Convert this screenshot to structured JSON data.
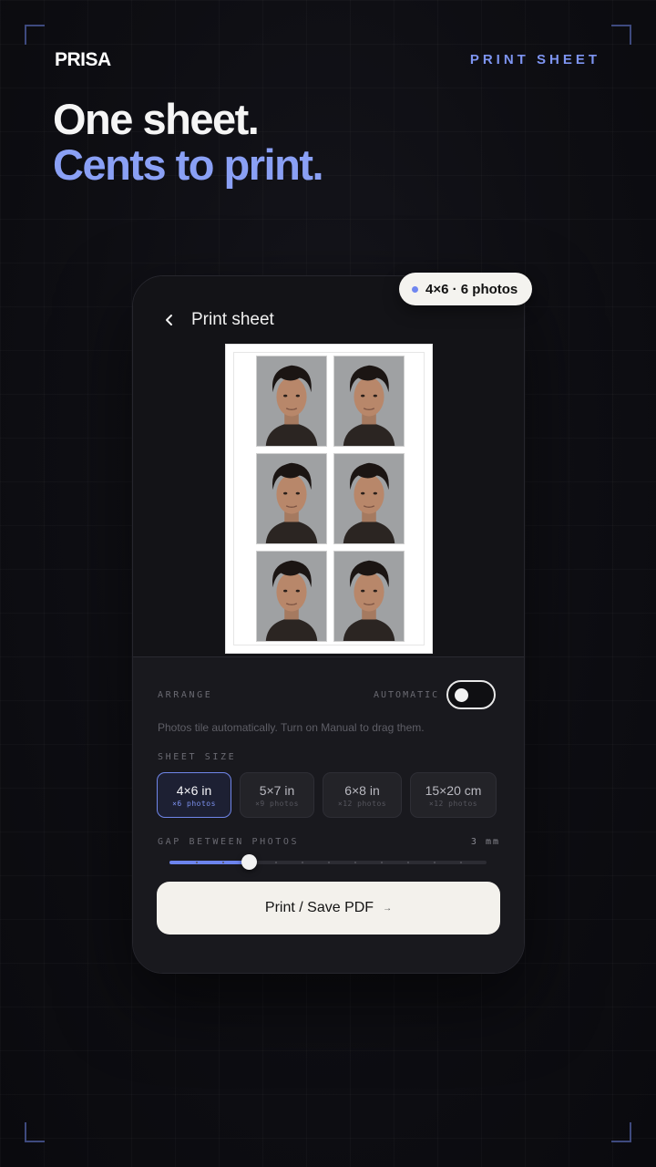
{
  "brand": "PRISA",
  "tag": "PRINT SHEET",
  "hero": {
    "line1": "One sheet.",
    "line2": "Cents to print."
  },
  "badge": {
    "label": "4×6 · 6 photos"
  },
  "screen": {
    "title": "Print sheet",
    "back_icon": "chevron-left-icon"
  },
  "sheet": {
    "photo_count": 6,
    "columns": 2,
    "rows": 3
  },
  "arrange": {
    "label": "ARRANGE",
    "mode_label": "AUTOMATIC",
    "toggle_on": false,
    "help": "Photos tile automatically. Turn on Manual to drag them."
  },
  "sheet_size": {
    "label": "SHEET SIZE",
    "options": [
      {
        "title": "4×6 in",
        "sub": "×6 photos",
        "active": true
      },
      {
        "title": "5×7 in",
        "sub": "×9 photos",
        "active": false
      },
      {
        "title": "6×8 in",
        "sub": "×12 photos",
        "active": false
      },
      {
        "title": "15×20 cm",
        "sub": "×12 photos",
        "active": false
      }
    ]
  },
  "gap": {
    "label": "GAP BETWEEN PHOTOS",
    "value_text": "3 mm",
    "value": 3,
    "min": 0,
    "max": 12
  },
  "cta": {
    "label": "Print / Save PDF",
    "arrow": "→"
  },
  "colors": {
    "accent": "#8aa0f5",
    "background": "#0e0e13",
    "button": "#f3f1ec"
  }
}
